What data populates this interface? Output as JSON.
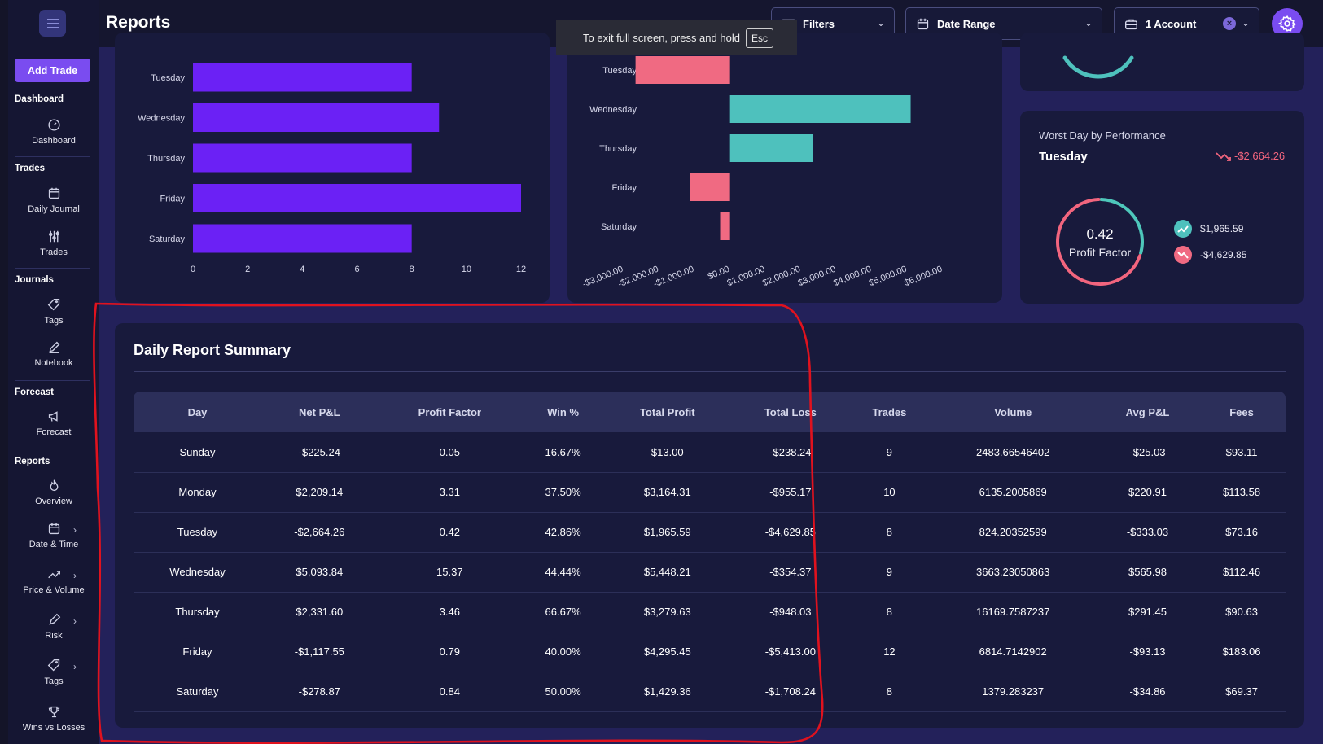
{
  "page": {
    "title": "Reports"
  },
  "fullscreen_tip": {
    "text": "To exit full screen, press and hold",
    "key": "Esc"
  },
  "topbar": {
    "filters_label": "Filters",
    "date_range_label": "Date Range",
    "account_label": "1 Account"
  },
  "sidebar": {
    "add_trade": "Add Trade",
    "sections": {
      "dashboard": "Dashboard",
      "trades": "Trades",
      "journals": "Journals",
      "forecast": "Forecast",
      "reports": "Reports"
    },
    "items": [
      {
        "label": "Dashboard",
        "icon": "dashboard-gauge-icon"
      },
      {
        "label": "Daily Journal",
        "icon": "calendar-icon"
      },
      {
        "label": "Trades",
        "icon": "sliders-icon"
      },
      {
        "label": "Tags",
        "icon": "tag-icon"
      },
      {
        "label": "Notebook",
        "icon": "edit-icon"
      },
      {
        "label": "Forecast",
        "icon": "megaphone-icon"
      },
      {
        "label": "Overview",
        "icon": "flame-icon"
      },
      {
        "label": "Date & Time",
        "icon": "calendar-clock-icon"
      },
      {
        "label": "Price & Volume",
        "icon": "trend-icon"
      },
      {
        "label": "Risk",
        "icon": "pen-icon"
      },
      {
        "label": "Tags",
        "icon": "tag-icon"
      },
      {
        "label": "Wins vs Losses",
        "icon": "trophy-icon"
      }
    ]
  },
  "chart_data": [
    {
      "type": "bar",
      "orientation": "horizontal",
      "categories": [
        "Tuesday",
        "Wednesday",
        "Thursday",
        "Friday",
        "Saturday"
      ],
      "values": [
        8,
        9,
        8,
        12,
        8
      ],
      "xticks": [
        "0",
        "2",
        "4",
        "6",
        "8",
        "10",
        "12"
      ],
      "xlim": [
        0,
        12
      ],
      "color": "#6b21f5"
    },
    {
      "type": "bar",
      "orientation": "horizontal",
      "categories": [
        "Tuesday",
        "Wednesday",
        "Thursday",
        "Friday",
        "Saturday"
      ],
      "values": [
        -2664.26,
        5093.84,
        2331.6,
        -1117.55,
        -278.87
      ],
      "xticks": [
        "-$3,000.00",
        "-$2,000.00",
        "-$1,000.00",
        "$0.00",
        "$1,000.00",
        "$2,000.00",
        "$3,000.00",
        "$4,000.00",
        "$5,000.00",
        "$6,000.00"
      ],
      "xlim": [
        -3000,
        6000
      ],
      "positive_color": "#4ec1bd",
      "negative_color": "#f06a82"
    }
  ],
  "worst_day": {
    "label": "Worst Day by Performance",
    "day": "Tuesday",
    "value": "-$2,664.26",
    "profit_factor": "0.42",
    "profit_factor_label": "Profit Factor",
    "total_profit": "$1,965.59",
    "total_loss": "-$4,629.85"
  },
  "summary": {
    "title": "Daily Report Summary",
    "columns": [
      "Day",
      "Net P&L",
      "Profit Factor",
      "Win %",
      "Total Profit",
      "Total Loss",
      "Trades",
      "Volume",
      "Avg P&L",
      "Fees"
    ],
    "rows": [
      [
        "Sunday",
        "-$225.24",
        "0.05",
        "16.67%",
        "$13.00",
        "-$238.24",
        "9",
        "2483.66546402",
        "-$25.03",
        "$93.11"
      ],
      [
        "Monday",
        "$2,209.14",
        "3.31",
        "37.50%",
        "$3,164.31",
        "-$955.17",
        "10",
        "6135.2005869",
        "$220.91",
        "$113.58"
      ],
      [
        "Tuesday",
        "-$2,664.26",
        "0.42",
        "42.86%",
        "$1,965.59",
        "-$4,629.85",
        "8",
        "824.20352599",
        "-$333.03",
        "$73.16"
      ],
      [
        "Wednesday",
        "$5,093.84",
        "15.37",
        "44.44%",
        "$5,448.21",
        "-$354.37",
        "9",
        "3663.23050863",
        "$565.98",
        "$112.46"
      ],
      [
        "Thursday",
        "$2,331.60",
        "3.46",
        "66.67%",
        "$3,279.63",
        "-$948.03",
        "8",
        "16169.7587237",
        "$291.45",
        "$90.63"
      ],
      [
        "Friday",
        "-$1,117.55",
        "0.79",
        "40.00%",
        "$4,295.45",
        "-$5,413.00",
        "12",
        "6814.7142902",
        "-$93.13",
        "$183.06"
      ],
      [
        "Saturday",
        "-$278.87",
        "0.84",
        "50.00%",
        "$1,429.36",
        "-$1,708.24",
        "8",
        "1379.283237",
        "-$34.86",
        "$69.37"
      ]
    ]
  },
  "colors": {
    "accent": "#7a4cf0",
    "positive": "#4ec7bb",
    "negative": "#f2657e",
    "annotation": "#e0121e"
  }
}
